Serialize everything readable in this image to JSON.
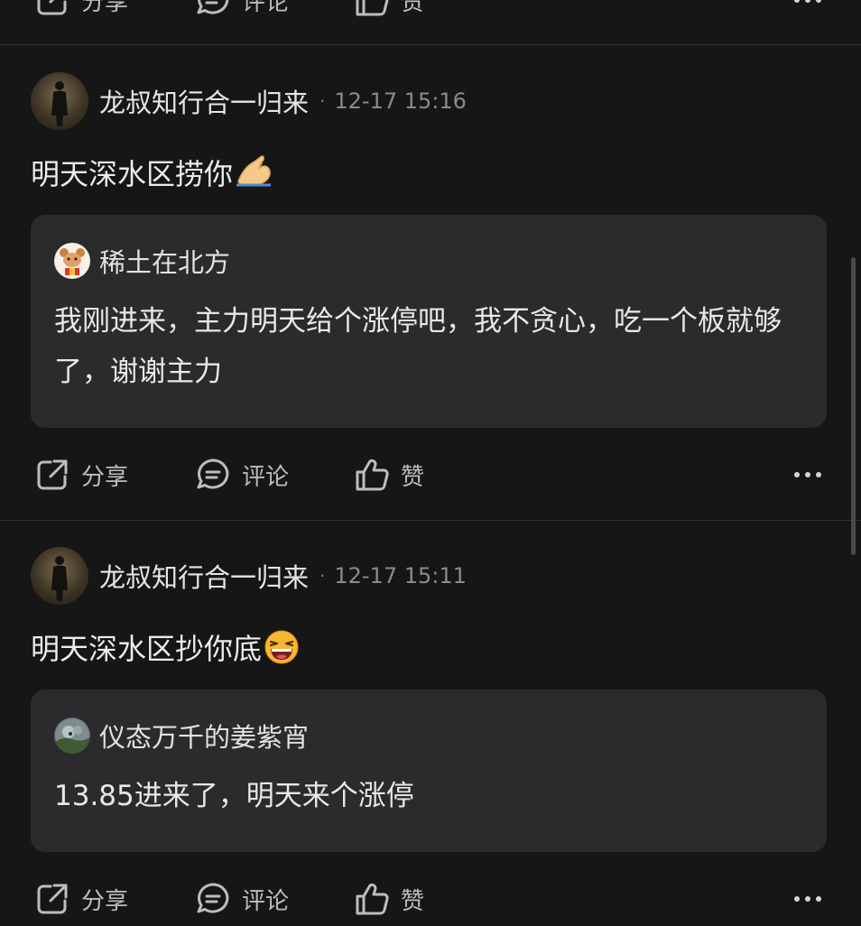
{
  "actions": {
    "share": "分享",
    "comment": "评论",
    "like": "赞"
  },
  "posts": [
    {
      "author": "龙叔知行合一归来",
      "dot": "·",
      "time": "12-17 15:16",
      "text": "明天深水区捞你",
      "emoji": "pinched-hand-emoji",
      "quote": {
        "author": "稀土在北方",
        "text": "我刚进来，主力明天给个涨停吧，我不贪心，吃一个板就够了，谢谢主力"
      }
    },
    {
      "author": "龙叔知行合一归来",
      "dot": "·",
      "time": "12-17 15:11",
      "text": "明天深水区抄你底",
      "emoji": "laughing-emoji",
      "quote": {
        "author": "仪态万千的姜紫宵",
        "text": "13.85进来了，明天来个涨停"
      }
    }
  ],
  "colors": {
    "background": "#161616",
    "quote_background": "#2b2b2d",
    "divider": "#333333",
    "secondary_text": "#bdbdbd"
  }
}
